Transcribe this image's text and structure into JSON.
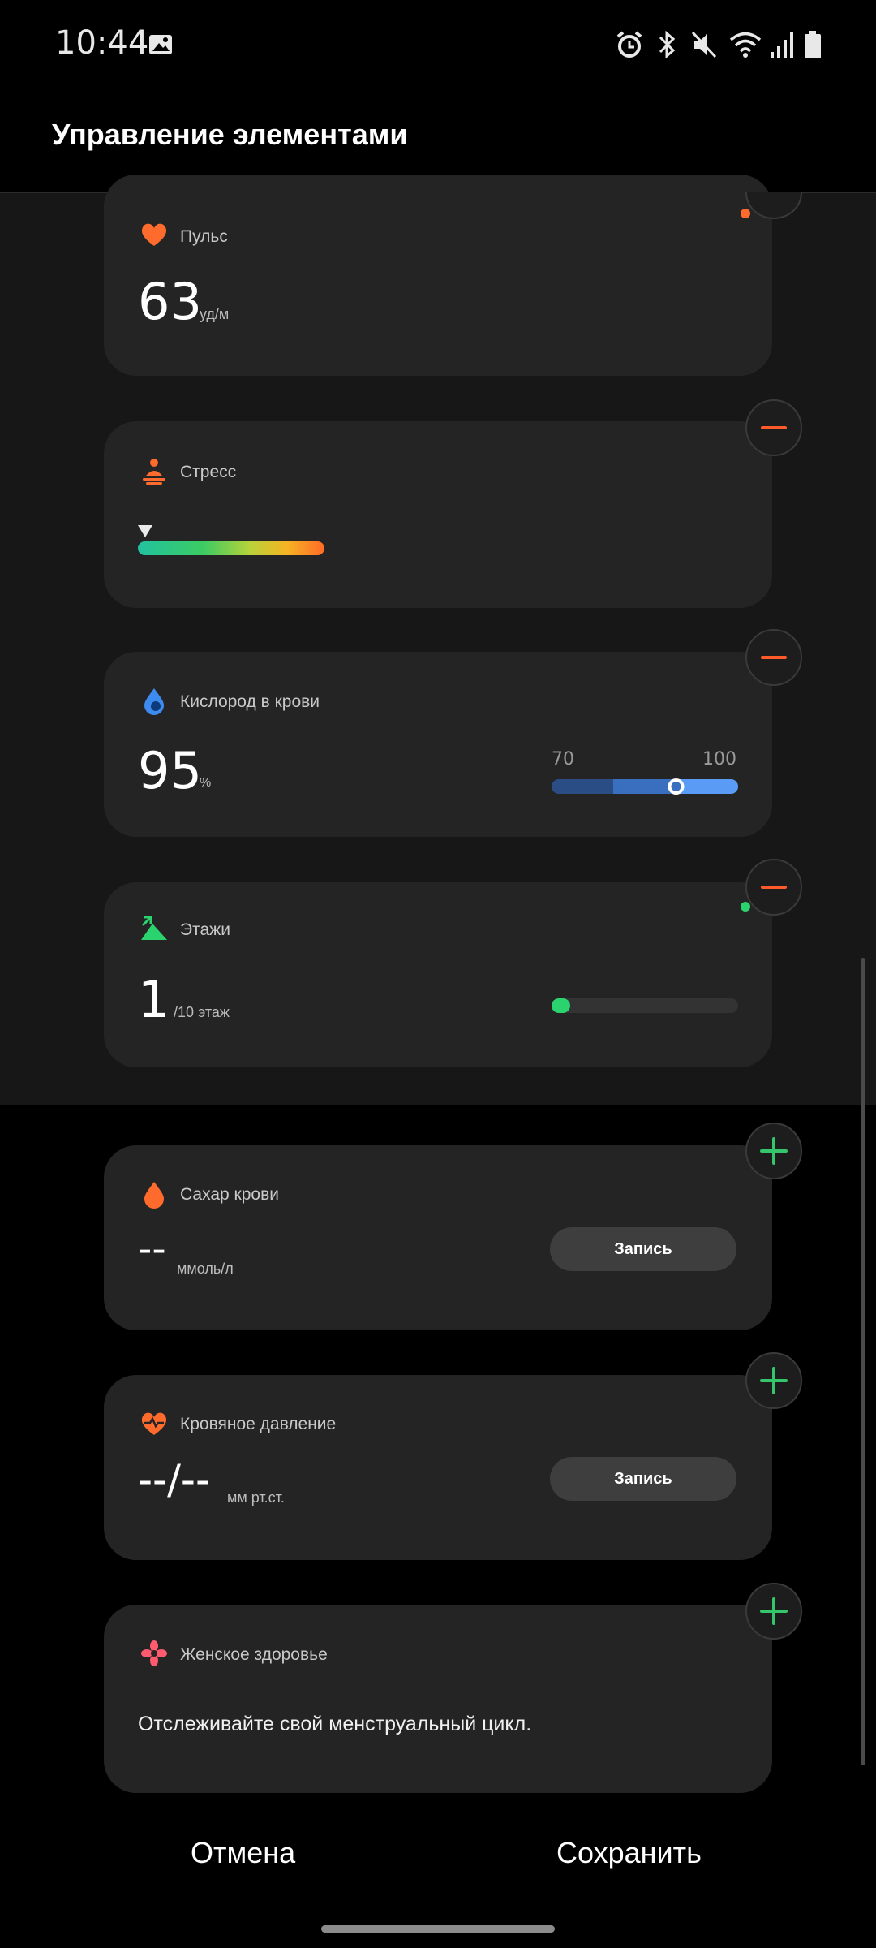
{
  "status_bar": {
    "time": "10:44",
    "icons": [
      "image-icon",
      "alarm-icon",
      "bluetooth-icon",
      "mute-icon",
      "wifi-icon",
      "signal-icon",
      "battery-icon"
    ]
  },
  "header": {
    "title": "Управление элементами"
  },
  "added_items": [
    {
      "title": "Пульс",
      "value": "63",
      "unit": "уд/м",
      "icon": "heart-icon",
      "color": "#ff6b2c"
    },
    {
      "title": "Стресс",
      "icon": "stress-icon",
      "color": "#ff6b2c",
      "level_fraction": 0.0
    },
    {
      "title": "Кислород в крови",
      "value": "95",
      "unit": "%",
      "icon": "oxygen-drop-icon",
      "color": "#3d8bf0",
      "range_min": "70",
      "range_max": "100",
      "marker_value": 95
    },
    {
      "title": "Этажи",
      "value": "1",
      "unit": "/10 этаж",
      "icon": "floors-icon",
      "color": "#2bd36e",
      "progress_fraction": 0.1
    }
  ],
  "available_items": [
    {
      "title": "Сахар крови",
      "value": "--",
      "unit": "ммоль/л",
      "icon": "blood-sugar-icon",
      "button": "Запись",
      "color": "#ff6b2c"
    },
    {
      "title": "Кровяное давление",
      "value": "--/--",
      "unit": "мм рт.ст.",
      "icon": "blood-pressure-icon",
      "button": "Запись",
      "color": "#ff6b2c"
    },
    {
      "title": "Женское здоровье",
      "text": "Отслеживайте свой менструальный цикл.",
      "icon": "womens-health-icon",
      "color": "#ff5a6e"
    }
  ],
  "footer": {
    "cancel": "Отмена",
    "save": "Сохранить"
  }
}
